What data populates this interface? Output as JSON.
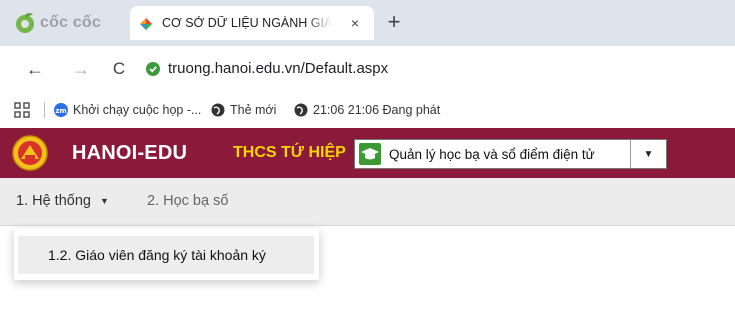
{
  "browser": {
    "brand": "cốc cốc",
    "tab": {
      "title": "CƠ SỞ DỮ LIỆU NGÀNH GIÁO",
      "close": "×"
    },
    "new_tab": "+",
    "nav": {
      "back": "←",
      "forward": "→",
      "reload": "C"
    },
    "url": "truong.hanoi.edu.vn/Default.aspx",
    "bookmarks": [
      {
        "label": "Khởi chạy cuộc họp -...",
        "icon": "zoom-icon"
      },
      {
        "label": "Thẻ mới",
        "icon": "globe-icon"
      },
      {
        "label": "21:06 21:06 Đang phát",
        "icon": "globe-icon"
      }
    ]
  },
  "header": {
    "site_name": "HANOI-EDU",
    "school": "THCS TỨ HIỆP",
    "module_select": {
      "selected": "Quản lý học bạ và sổ điểm điện tử"
    },
    "colors": {
      "header_bg": "#8b1a3a",
      "school_text": "#f7d400",
      "module_icon": "#3b9a35"
    }
  },
  "menu": {
    "items": [
      {
        "label": "1. Hệ thống",
        "caret": "▼"
      },
      {
        "label": "2. Học bạ số"
      }
    ],
    "dropdown": {
      "items": [
        {
          "label": "1.2. Giáo viên đăng ký tài khoản ký"
        }
      ]
    }
  }
}
